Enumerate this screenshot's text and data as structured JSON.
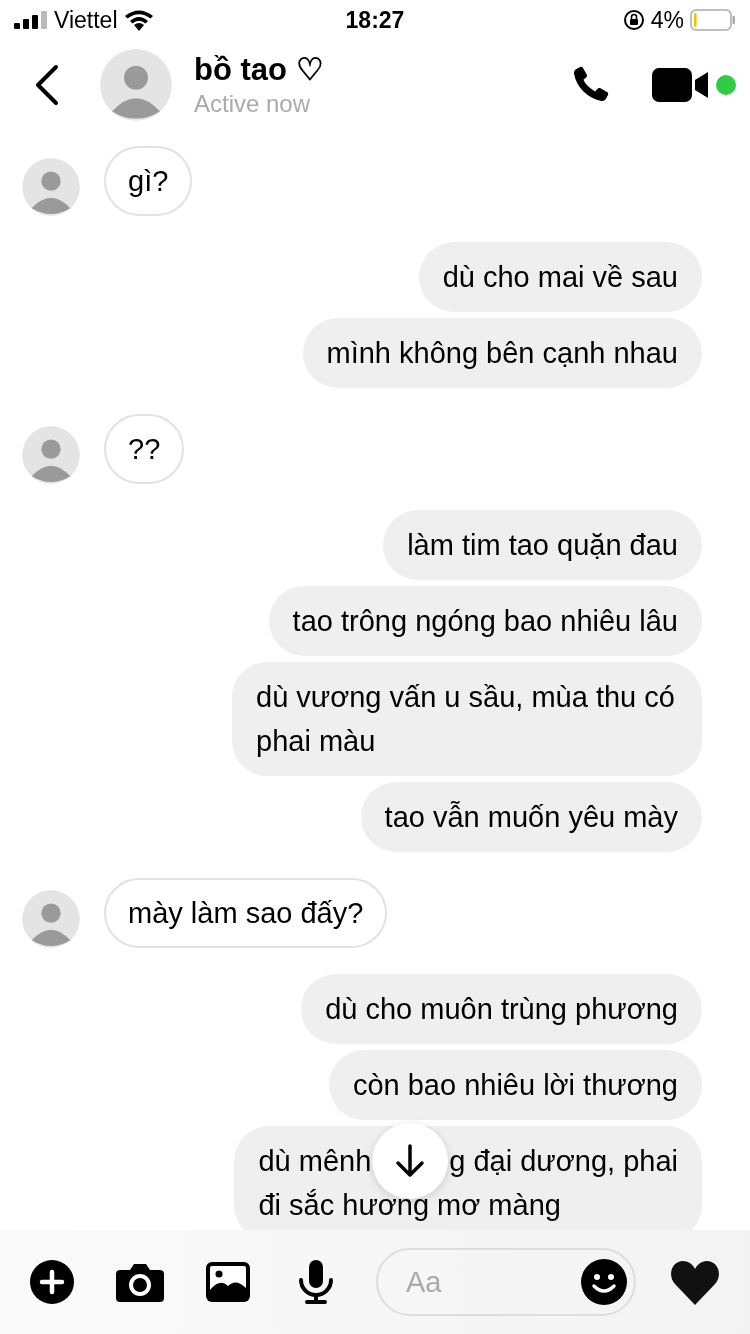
{
  "status_bar": {
    "carrier": "Viettel",
    "time": "18:27",
    "battery": "4%"
  },
  "header": {
    "name": "bồ tao ♡",
    "status": "Active now"
  },
  "groups": [
    {
      "kind": "received",
      "messages": [
        {
          "text": "gì?"
        }
      ]
    },
    {
      "kind": "sent",
      "messages": [
        {
          "text": "dù cho mai về sau"
        },
        {
          "text": "mình không bên cạnh nhau"
        }
      ]
    },
    {
      "kind": "received",
      "messages": [
        {
          "text": "??"
        }
      ]
    },
    {
      "kind": "sent",
      "messages": [
        {
          "text": "làm tim tao quặn đau"
        },
        {
          "text": "tao trông ngóng bao nhiêu lâu"
        },
        {
          "text": "dù vương vấn u sầu, mùa thu có phai màu"
        },
        {
          "text": "tao vẫn muốn yêu mày"
        }
      ]
    },
    {
      "kind": "received",
      "messages": [
        {
          "text": "mày làm sao đấy?"
        }
      ]
    },
    {
      "kind": "sent",
      "messages": [
        {
          "text": "dù cho muôn trùng phương"
        },
        {
          "text": "còn bao nhiêu lời thương"
        },
        {
          "parts": [
            "dù mênh",
            "g đại dương, phai",
            "đi sắc hương mơ màng"
          ]
        }
      ]
    }
  ],
  "composer": {
    "placeholder": "Aa"
  }
}
